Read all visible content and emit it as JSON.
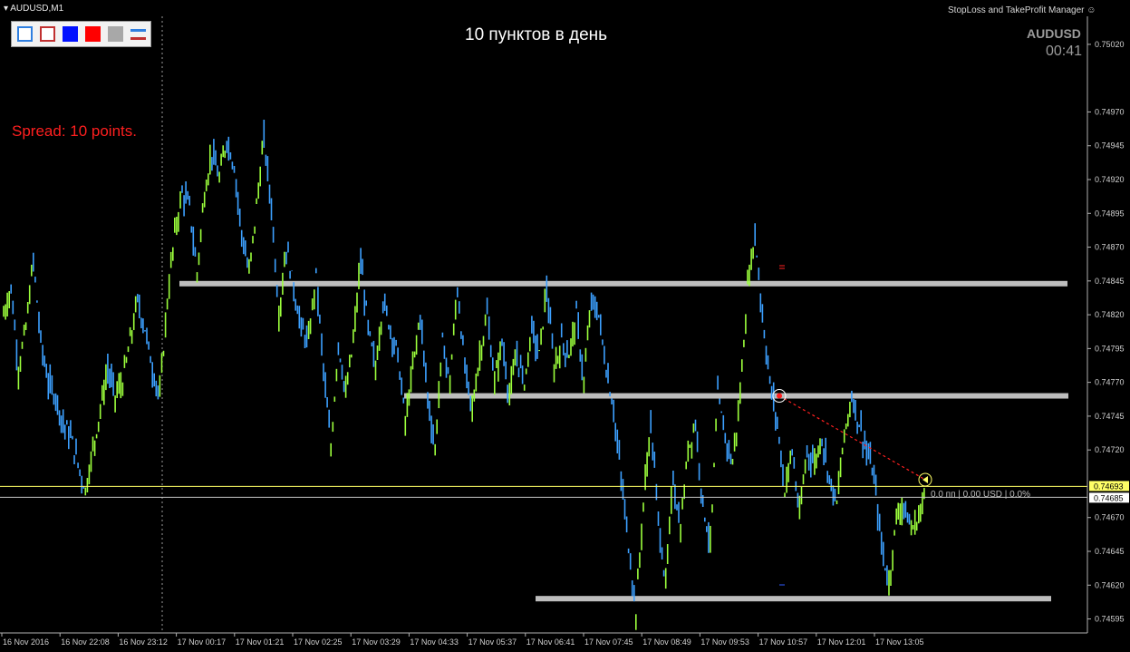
{
  "window": {
    "title": "AUDUSD,M1"
  },
  "headline": "10 пунктов в день",
  "spread_label": "Spread: 10 points.",
  "manager_title": "StopLoss and TakeProfit Manager",
  "symbol": "AUDUSD",
  "clock": "00:41",
  "position_info": "0.0 пп | 0.00 USD | 0.0%",
  "toolbar": {
    "buttons": [
      {
        "name": "blue-outline-button",
        "fill": "#ffffff",
        "border": "#2f7fe0"
      },
      {
        "name": "red-outline-button",
        "fill": "#ffffff",
        "border": "#c03030"
      },
      {
        "name": "blue-fill-button",
        "fill": "#0010ff",
        "border": "#0010ff"
      },
      {
        "name": "red-fill-button",
        "fill": "#ff0000",
        "border": "#ff0000"
      },
      {
        "name": "gray-fill-button",
        "fill": "#a8a8a8",
        "border": "#a8a8a8"
      },
      {
        "name": "line-style-button",
        "fill": "#f2f2f2",
        "border": "#f2f2f2"
      }
    ]
  },
  "colors": {
    "background": "#000000",
    "bull": "#9cff3c",
    "bear": "#3ca0ff",
    "level": "#bdbdbd",
    "bid_line": "#ffff66",
    "ask_line": "#c8c8c8",
    "projection": "#ff2020",
    "spread_text": "#ff1f1f"
  },
  "chart_data": {
    "type": "line",
    "title": "",
    "symbol": "AUDUSD",
    "timeframe": "M1",
    "y_ticks": [
      "0.75020",
      "0.74970",
      "0.74945",
      "0.74920",
      "0.74895",
      "0.74870",
      "0.74845",
      "0.74820",
      "0.74795",
      "0.74770",
      "0.74745",
      "0.74720",
      "0.74670",
      "0.74645",
      "0.74620",
      "0.74595"
    ],
    "x_ticks": [
      "16 Nov 2016",
      "16 Nov 22:08",
      "16 Nov 23:12",
      "17 Nov 00:17",
      "17 Nov 01:21",
      "17 Nov 02:25",
      "17 Nov 03:29",
      "17 Nov 04:33",
      "17 Nov 05:37",
      "17 Nov 06:41",
      "17 Nov 07:45",
      "17 Nov 08:49",
      "17 Nov 09:53",
      "17 Nov 10:57",
      "17 Nov 12:01",
      "17 Nov 13:05"
    ],
    "ylim": [
      0.7459,
      0.7503
    ],
    "price_bid_label": "0.74693",
    "price_ask_label": "0.74685",
    "bid": 0.74693,
    "ask": 0.74685,
    "levels": [
      {
        "name": "resistance",
        "price": 0.74843,
        "x_start": "17 Nov 00:17",
        "x_end": "17 Nov 13:05+"
      },
      {
        "name": "middle",
        "price": 0.7476,
        "x_start": "17 Nov 04:15",
        "x_end": "17 Nov 13:05+"
      },
      {
        "name": "support",
        "price": 0.7461,
        "x_start": "17 Nov 06:20",
        "x_end": "17 Nov 13:05+"
      }
    ],
    "projection": {
      "from_price": 0.7476,
      "to_price": 0.74698
    },
    "series": [
      {
        "values": [
          0.7482,
          0.7484,
          0.7478,
          0.7481,
          0.7486,
          0.748,
          0.7477,
          0.7476,
          0.7474,
          0.7473,
          0.7471,
          0.7469,
          0.7472,
          0.7475,
          0.7478,
          0.7476,
          0.7477,
          0.748,
          0.7483,
          0.7481,
          0.7478,
          0.7476,
          0.7483,
          0.7488,
          0.7491,
          0.749,
          0.7485,
          0.7491,
          0.7494,
          0.7492,
          0.7495,
          0.7493,
          0.7488,
          0.7485,
          0.749,
          0.7495,
          0.749,
          0.7482,
          0.7487,
          0.7484,
          0.7481,
          0.748,
          0.7485,
          0.7478,
          0.7472,
          0.748,
          0.7476,
          0.748,
          0.7486,
          0.7481,
          0.7478,
          0.7483,
          0.7481,
          0.7479,
          0.7474,
          0.7478,
          0.7482,
          0.7476,
          0.7472,
          0.748,
          0.7477,
          0.7484,
          0.7478,
          0.7475,
          0.7479,
          0.7482,
          0.7477,
          0.748,
          0.7476,
          0.7479,
          0.7477,
          0.7481,
          0.7479,
          0.7484,
          0.7478,
          0.748,
          0.7479,
          0.7482,
          0.7477,
          0.7483,
          0.7482,
          0.7478,
          0.7475,
          0.747,
          0.7465,
          0.746,
          0.7468,
          0.7474,
          0.7467,
          0.7462,
          0.747,
          0.7466,
          0.7472,
          0.7474,
          0.7468,
          0.7465,
          0.7476,
          0.7473,
          0.7471,
          0.7476,
          0.7484,
          0.7488,
          0.7482,
          0.7477,
          0.7474,
          0.7469,
          0.7472,
          0.7467,
          0.7472,
          0.7471,
          0.7473,
          0.747,
          0.7468,
          0.7473,
          0.7476,
          0.7474,
          0.7472,
          0.747,
          0.7465,
          0.7462,
          0.7467,
          0.7468,
          0.7466,
          0.7467,
          0.7469
        ]
      }
    ]
  }
}
